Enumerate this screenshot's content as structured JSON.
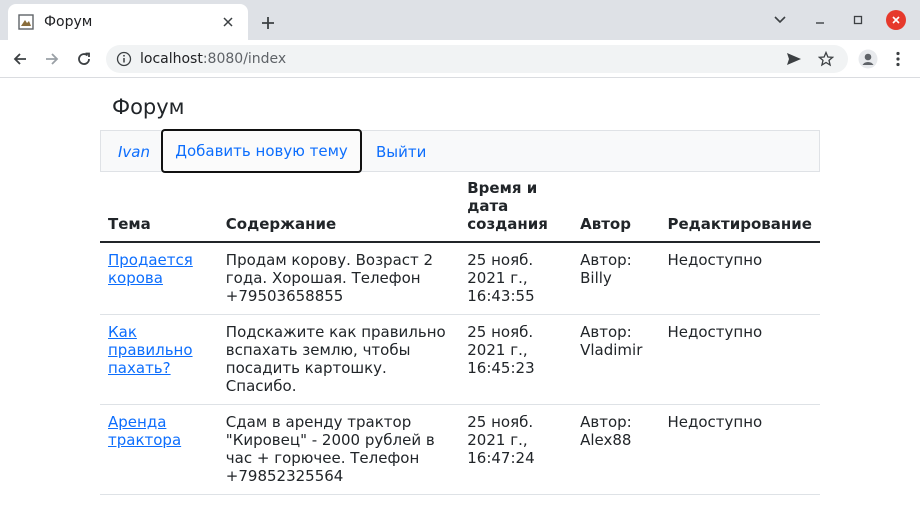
{
  "browser": {
    "tab_title": "Форум",
    "url_host": "localhost",
    "url_rest": ":8080/index"
  },
  "page": {
    "title": "Форум",
    "nav": {
      "user": "Ivan",
      "add_topic": "Добавить новую тему",
      "logout": "Выйти"
    },
    "table": {
      "headers": {
        "topic": "Тема",
        "content": "Содержание",
        "date_line1": "Время и",
        "date_line2": "дата",
        "date_line3": "создания",
        "author": "Автор",
        "edit": "Редактирование"
      },
      "rows": [
        {
          "topic": "Продается корова",
          "content": "Продам корову. Возраст 2 года. Хорошая. Телефон +79503658855",
          "date_day": "25 нояб.",
          "date_year": "2021 г.,",
          "date_time": "16:43:55",
          "author": "Автор: Billy",
          "edit": "Недоступно"
        },
        {
          "topic": "Как правильно пахать?",
          "content": "Подскажите как правильно вспахать землю, чтобы посадить картошку. Спасибо.",
          "date_day": "25 нояб.",
          "date_year": "2021 г.,",
          "date_time": "16:45:23",
          "author": "Автор: Vladimir",
          "edit": "Недоступно"
        },
        {
          "topic": "Аренда трактора",
          "content": "Сдам в аренду трактор \"Кировец\" - 2000 рублей в час + горючее. Телефон +79852325564",
          "date_day": "25 нояб.",
          "date_year": "2021 г.,",
          "date_time": "16:47:24",
          "author": "Автор: Alex88",
          "edit": "Недоступно"
        }
      ]
    }
  }
}
